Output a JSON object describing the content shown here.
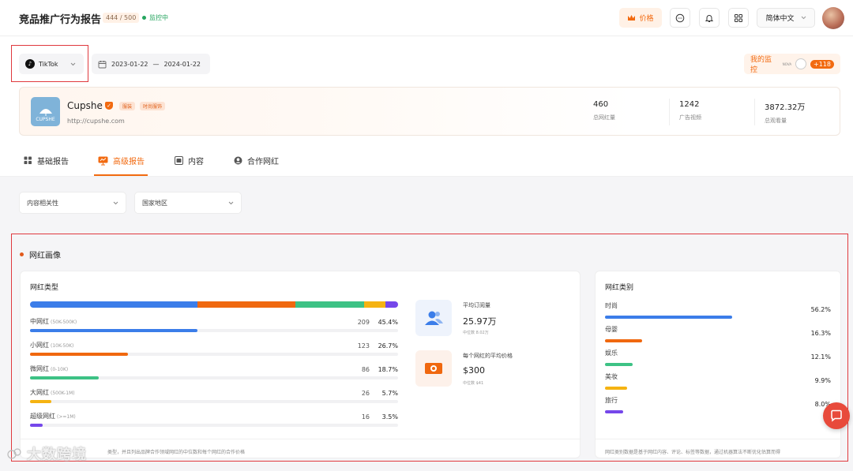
{
  "header": {
    "title": "竞品推广行为报告",
    "quota": "444 / 500",
    "status": "监控中",
    "price_label": "价格",
    "language": "简体中文"
  },
  "toolbar": {
    "platform": "TikTok",
    "date_start": "2023-01-22",
    "date_sep": "—",
    "date_end": "2024-01-22",
    "monitor_label": "我的监控",
    "monitor_extra": "+118"
  },
  "brand": {
    "name": "Cupshe",
    "logo_text": "CUPSHE",
    "url": "http://cupshe.com",
    "tags": [
      "服装",
      "时尚服饰"
    ],
    "stats": [
      {
        "value": "460",
        "label": "总网红量"
      },
      {
        "value": "1242",
        "label": "广告视频"
      },
      {
        "value": "3872.32万",
        "label": "总观看量"
      }
    ]
  },
  "tabs": [
    {
      "label": "基础报告",
      "icon": "grid-icon"
    },
    {
      "label": "高级报告",
      "icon": "chart-icon"
    },
    {
      "label": "内容",
      "icon": "content-icon"
    },
    {
      "label": "合作网红",
      "icon": "user-icon"
    }
  ],
  "filters": {
    "relevance": "内容相关性",
    "region": "国家地区"
  },
  "section": {
    "title": "网红画像",
    "type_panel": {
      "title": "网红类型",
      "stacked": [
        {
          "pct": 45.4,
          "color": "#3b7de9"
        },
        {
          "pct": 26.7,
          "color": "#f0680f"
        },
        {
          "pct": 18.7,
          "color": "#3dc285"
        },
        {
          "pct": 5.7,
          "color": "#f5b312"
        },
        {
          "pct": 3.5,
          "color": "#7547ea"
        }
      ],
      "rows": [
        {
          "name": "中网红",
          "range": "(50K-500K)",
          "count": "209",
          "pct": "45.4%",
          "value": 45.4,
          "color": "#3b7de9"
        },
        {
          "name": "小网红",
          "range": "(10K-50K)",
          "count": "123",
          "pct": "26.7%",
          "value": 26.7,
          "color": "#f0680f"
        },
        {
          "name": "微网红",
          "range": "(0-10K)",
          "count": "86",
          "pct": "18.7%",
          "value": 18.7,
          "color": "#3dc285"
        },
        {
          "name": "大网红",
          "range": "(500K-1M)",
          "count": "26",
          "pct": "5.7%",
          "value": 5.7,
          "color": "#f5b312"
        },
        {
          "name": "超级网红",
          "range": "(>=1M)",
          "count": "16",
          "pct": "3.5%",
          "value": 3.5,
          "color": "#7547ea"
        }
      ],
      "metrics": [
        {
          "label": "平均订阅量",
          "value": "25.97万",
          "sub": "中位数 8.02万"
        },
        {
          "label": "每个网红的平均价格",
          "value": "$300",
          "sub": "中位数 $41"
        }
      ],
      "footnote": "类型，并且列出品牌合作领域网红的中位数和每个网红的合作价格"
    },
    "category_panel": {
      "title": "网红类别",
      "rows": [
        {
          "name": "时尚",
          "pct": "56.2%",
          "value": 56.2,
          "color": "#3b7de9"
        },
        {
          "name": "母婴",
          "pct": "16.3%",
          "value": 16.3,
          "color": "#f0680f"
        },
        {
          "name": "娱乐",
          "pct": "12.1%",
          "value": 12.1,
          "color": "#3dc285"
        },
        {
          "name": "美妆",
          "pct": "9.9%",
          "value": 9.9,
          "color": "#f5b312"
        },
        {
          "name": "旅行",
          "pct": "8.0%",
          "value": 8.0,
          "color": "#7547ea"
        }
      ],
      "footnote": "网红类别数据是基于网红内容、评论、标签等数据，通过机器算法不断优化估算而得"
    }
  },
  "watermark": "大数跨境"
}
